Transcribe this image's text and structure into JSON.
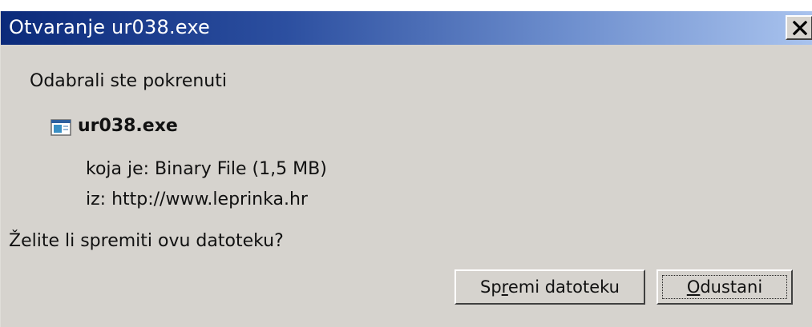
{
  "window": {
    "title": "Otvaranje ur038.exe",
    "close_icon": "close-icon"
  },
  "content": {
    "intro": "Odabrali ste pokrenuti",
    "file_icon": "executable-file-icon",
    "file_name": "ur038.exe",
    "file_type": "koja je:  Binary File (1,5 MB)",
    "file_source": "iz:  http://www.leprinka.hr",
    "question": "Želite li spremiti ovu datoteku?"
  },
  "buttons": {
    "save": {
      "label": "Spremi datoteku",
      "before": "Sp",
      "accel": "r",
      "after": "emi datoteku"
    },
    "cancel": {
      "label": "Odustani",
      "before": "",
      "accel": "O",
      "after": "dustani"
    }
  },
  "colors": {
    "titlebar_start": "#0b2a7a",
    "titlebar_end": "#a9c3ee",
    "dialog_bg": "#d6d3ce"
  }
}
